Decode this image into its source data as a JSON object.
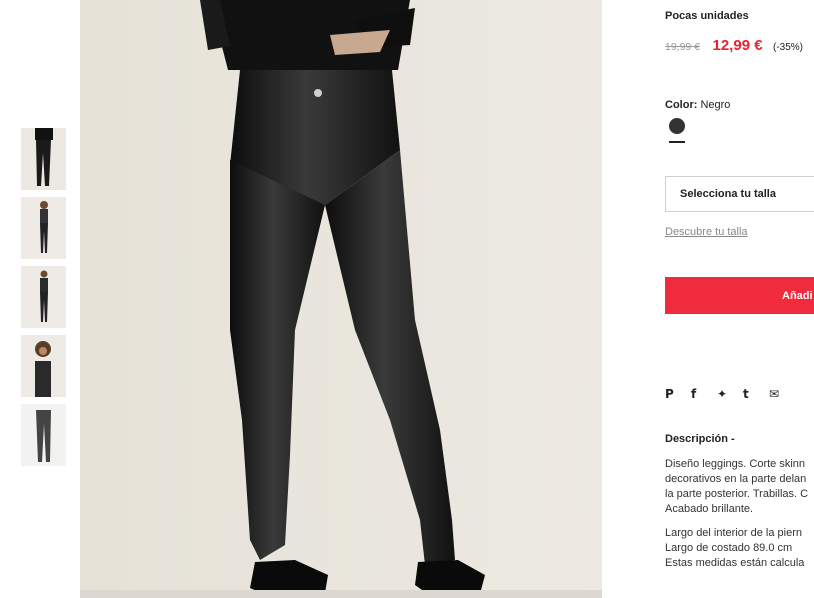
{
  "product": {
    "stock_label": "Pocas unidades",
    "price_old": "19,99 €",
    "price_new": "12,99 €",
    "discount": "(-35%)",
    "color_label": "Color:",
    "color_value": "Negro",
    "swatch_color": "#333333",
    "size_select": "Selecciona tu talla",
    "size_guide": "Descubre tu talla",
    "add_button": "Añadi"
  },
  "social": {
    "pinterest": "P",
    "facebook": "f",
    "twitter": "✦",
    "tumblr": "t",
    "email": "✉"
  },
  "description": {
    "title": "Descripción -",
    "lines_a": [
      "Diseño leggings. Corte skinn",
      "decorativos en la parte delan",
      "la parte posterior. Trabillas. C",
      "Acabado brillante."
    ],
    "lines_b": [
      "Largo del interior de la piern",
      "Largo de costado 89.0 cm",
      "Estas medidas están calcula"
    ]
  },
  "colors": {
    "accent": "#ef2b3d",
    "price_sale": "#e8232f"
  }
}
